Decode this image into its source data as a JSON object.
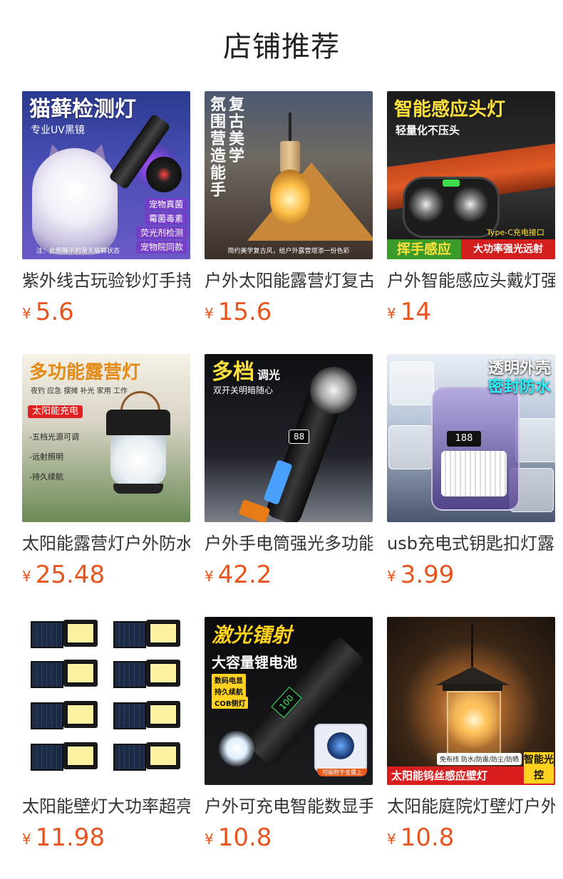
{
  "page": {
    "title": "店铺推荐"
  },
  "currency_symbol": "¥",
  "products": [
    {
      "name": "紫外线古玩验钞灯手持",
      "price": "5.6",
      "image": {
        "headline": "猫藓检测灯",
        "subline": "专业UV黑镜",
        "tags": [
          "宠物真菌",
          "霉菌毒素",
          "荧光剂检测",
          "宠物院同款"
        ],
        "footnote": "注：此图展示的是无猫藓状态"
      }
    },
    {
      "name": "户外太阳能露营灯复古",
      "price": "15.6",
      "image": {
        "vertical_line_1": "氛围营造能手",
        "vertical_line_2": "复古美学",
        "footnote": "简约美学复古风，给户外露营增添一份色彩"
      }
    },
    {
      "name": "户外智能感应头戴灯强光",
      "price": "14",
      "image": {
        "headline": "智能感应头灯",
        "subline": "轻量化不压头",
        "band_left": "挥手感应",
        "band_right": "大功率强光远射",
        "note": "Type-C充电接口"
      }
    },
    {
      "name": "太阳能露营灯户外防水",
      "price": "25.48",
      "image": {
        "headline": "多功能露营灯",
        "subline": "夜钓 应急 摆摊 补光 家用 工作",
        "red_tag": "太阳能充电",
        "bullets": [
          "-五档光源可调",
          "-远射照明",
          "-持久续航"
        ]
      }
    },
    {
      "name": "户外手电筒强光多功能",
      "price": "42.2",
      "image": {
        "headline": "多档",
        "headline_small": "调光",
        "subline": "双开关明暗随心",
        "display": "88"
      }
    },
    {
      "name": "usb充电式钥匙扣灯露营",
      "price": "3.99",
      "image": {
        "headline_1": "透明外壳",
        "headline_2": "密封防水",
        "display": "188"
      }
    },
    {
      "name": "太阳能壁灯大功率超亮",
      "price": "11.98",
      "image": {}
    },
    {
      "name": "户外可充电智能数显手电",
      "price": "10.8",
      "image": {
        "headline": "激光镭射",
        "subline": "大容量锂电池",
        "chips": [
          "数码电显",
          "持久续航",
          "COB侧灯"
        ],
        "display": "100",
        "inset_caption": "可吸附于金属上"
      }
    },
    {
      "name": "太阳能庭院灯壁灯户外",
      "price": "10.8",
      "image": {
        "band": "太阳能钨丝感应壁灯",
        "side": "智能光控",
        "chips": "免布线 防水/防雷/防尘/防晒"
      }
    }
  ]
}
